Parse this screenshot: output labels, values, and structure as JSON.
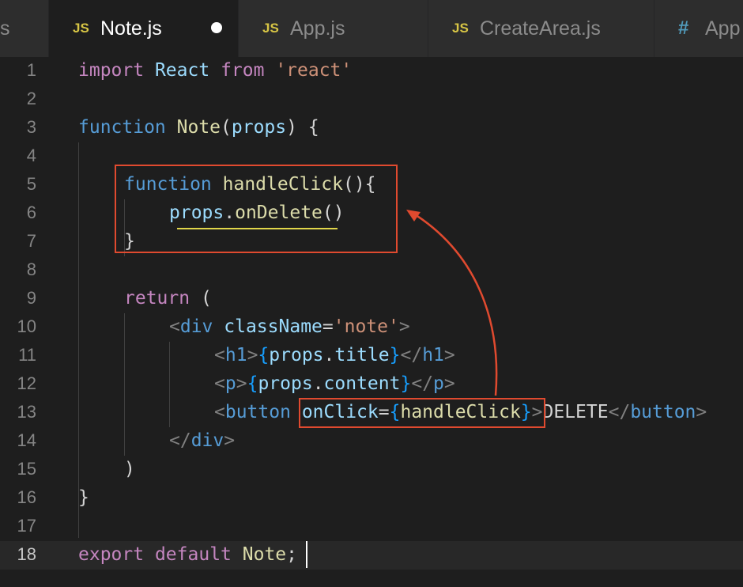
{
  "tabs": [
    {
      "lang": "JS",
      "label": "Note.js",
      "active": true,
      "modified": true
    },
    {
      "lang": "JS",
      "label": "App.js",
      "active": false
    },
    {
      "lang": "JS",
      "label": "CreateArea.js",
      "active": false
    },
    {
      "lang": "#",
      "label": "App",
      "active": false
    }
  ],
  "partial_tab_glyph": "s",
  "line_numbers": [
    "1",
    "2",
    "3",
    "4",
    "5",
    "6",
    "7",
    "8",
    "9",
    "10",
    "11",
    "12",
    "13",
    "14",
    "15",
    "16",
    "17",
    "18"
  ],
  "code": {
    "l1": {
      "kw_import": "import",
      "name": "React",
      "kw_from": "from",
      "str": "'react'"
    },
    "l3": {
      "kw": "function",
      "fn": "Note",
      "open": "(",
      "param": "props",
      "close": ") {"
    },
    "l5": {
      "kw": "function",
      "fn": "handleClick",
      "rest": "(){"
    },
    "l6": {
      "obj": "props",
      "dot": ".",
      "fn": "onDelete",
      "rest": "()"
    },
    "l7": {
      "rest": "}"
    },
    "l9": {
      "kw": "return",
      "rest": " ("
    },
    "l10": {
      "lt": "<",
      "tag": "div",
      "attr": "className",
      "eq": "=",
      "val": "'note'",
      "gt": ">"
    },
    "l11": {
      "lt": "<",
      "tag": "h1",
      "gt": ">",
      "ob": "{",
      "obj": "props",
      "dot": ".",
      "prop": "title",
      "cb": "}",
      "lt2": "</",
      "tag2": "h1",
      "gt2": ">"
    },
    "l12": {
      "lt": "<",
      "tag": "p",
      "gt": ">",
      "ob": "{",
      "obj": "props",
      "dot": ".",
      "prop": "content",
      "cb": "}",
      "lt2": "</",
      "tag2": "p",
      "gt2": ">"
    },
    "l13": {
      "lt": "<",
      "tag": "button",
      "attr": "onClick",
      "eq": "=",
      "ob": "{",
      "fn": "handleClick",
      "cb": "}",
      "gt": ">",
      "text": "DELETE",
      "lt2": "</",
      "tag2": "button",
      "gt2": ">"
    },
    "l14": {
      "lt": "</",
      "tag": "div",
      "gt": ">"
    },
    "l15": {
      "rest": ")"
    },
    "l16": {
      "rest": "}"
    },
    "l18": {
      "kw_export": "export",
      "kw_default": "default",
      "name": "Note",
      "semi": ";"
    }
  },
  "annotation_color": "#e04a2f"
}
